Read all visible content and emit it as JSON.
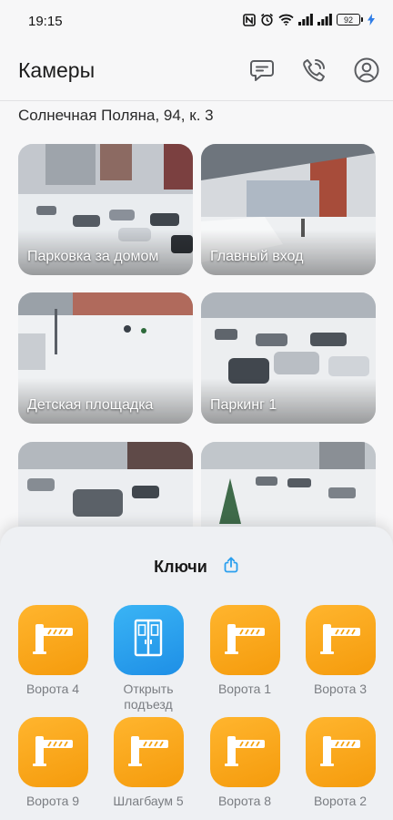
{
  "status_bar": {
    "time": "19:15",
    "battery": "92",
    "icons": [
      "nfc-icon",
      "alarm-icon",
      "wifi-icon",
      "signal-icon",
      "signal-icon",
      "battery-icon",
      "charging-icon"
    ]
  },
  "app_bar": {
    "title": "Камеры",
    "icons": [
      "chat-icon",
      "phone-call-icon",
      "profile-icon"
    ]
  },
  "address": "Солнечная Поляна, 94, к. 3",
  "cameras": [
    {
      "label": "Парковка за домом"
    },
    {
      "label": "Главный вход"
    },
    {
      "label": "Детская площадка"
    },
    {
      "label": "Паркинг 1"
    },
    {
      "label": ""
    },
    {
      "label": ""
    }
  ],
  "keys_sheet": {
    "title": "Ключи",
    "keys": [
      {
        "label": "Ворота 4",
        "icon": "barrier-gate-icon",
        "color": "#f8a51a"
      },
      {
        "label": "Открыть подъезд",
        "icon": "door-icon",
        "color": "#2a9fee"
      },
      {
        "label": "Ворота 1",
        "icon": "barrier-gate-icon",
        "color": "#f8a51a"
      },
      {
        "label": "Ворота 3",
        "icon": "barrier-gate-icon",
        "color": "#f8a51a"
      },
      {
        "label": "Ворота 9",
        "icon": "barrier-gate-icon",
        "color": "#f8a51a"
      },
      {
        "label": "Шлагбаум 5",
        "icon": "barrier-gate-icon",
        "color": "#f8a51a"
      },
      {
        "label": "Ворота 8",
        "icon": "barrier-gate-icon",
        "color": "#f8a51a"
      },
      {
        "label": "Ворота 2",
        "icon": "barrier-gate-icon",
        "color": "#f8a51a"
      }
    ]
  }
}
